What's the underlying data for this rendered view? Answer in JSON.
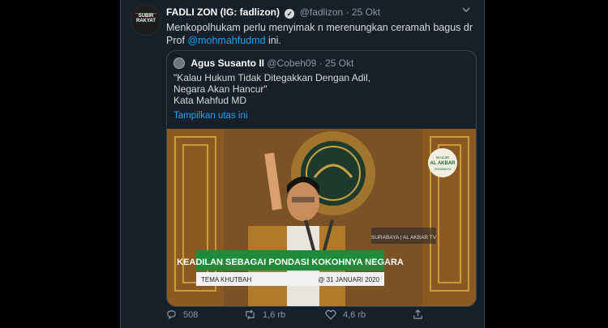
{
  "tweet": {
    "avatar_text": "SUBIR RAKYAT",
    "author_name": "FADLI ZON (IG: fadlizon)",
    "handle": "@fadlizon",
    "separator": "·",
    "date": "25 Okt",
    "text_before": "Menkopolhukam perlu menyimak n merenungkan ceramah bagus dr Prof ",
    "mention": "@mohmahfudmd",
    "text_after": " ini."
  },
  "quote": {
    "author_name": "Agus Susanto II",
    "handle": "@Cobeh09",
    "separator": "·",
    "date": "25 Okt",
    "text": "\"Kalau Hukum Tidak Ditegakkan Dengan Adil,\nNegara Akan Hancur\"\nKata Mahfud MD",
    "show_thread": "Tampilkan utas ini"
  },
  "media": {
    "logo_line1": "MASJID",
    "logo_line2": "AL AKBAR",
    "logo_line3": "SURABAYA",
    "caption_small": "SURABAYA | AL AKBAR TV",
    "banner": "KEADILAN SEBAGAI PONDASI KOKOHNYA NEGARA",
    "sub_left": "TEMA KHUTBAH",
    "sub_right": "@ 31 JANUARI 2020"
  },
  "actions": {
    "replies": "508",
    "retweets": "1,6 rb",
    "likes": "4,6 rb"
  },
  "colors": {
    "background": "#15202b",
    "link": "#1da1f2",
    "banner_green": "#1f8a3a"
  }
}
